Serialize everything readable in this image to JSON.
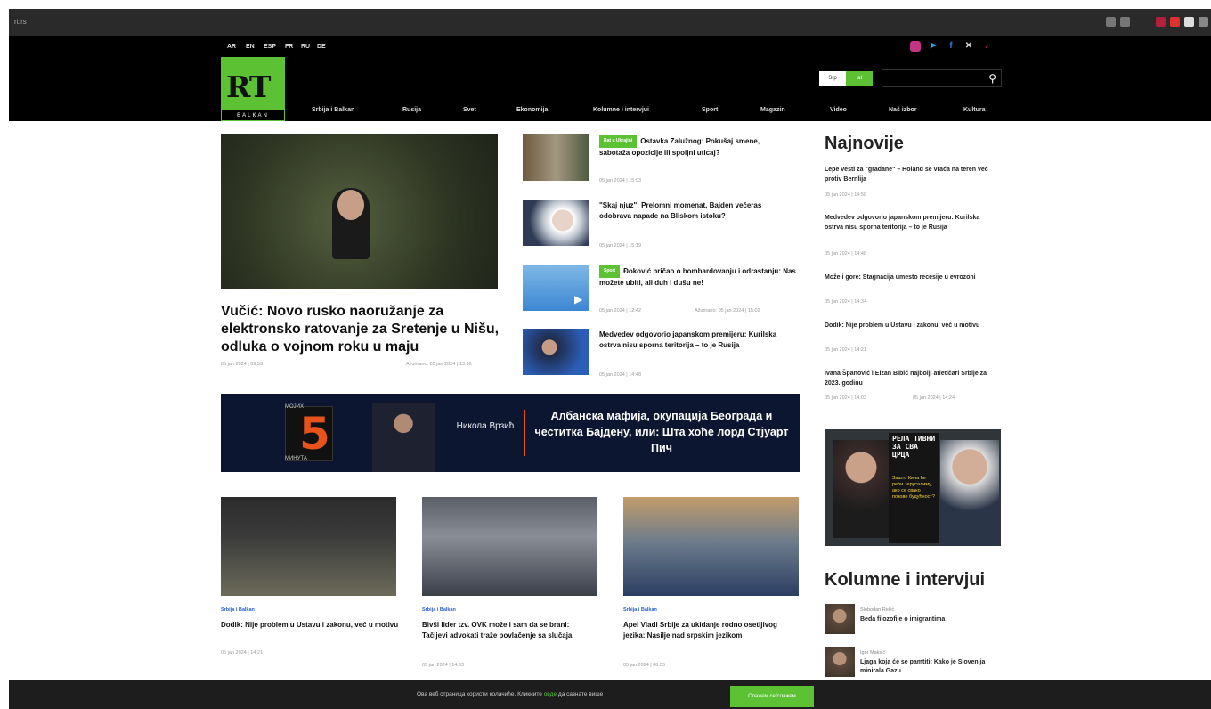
{
  "browser": {
    "url": "rt.rs",
    "extension_colors": [
      "#777777",
      "#777777",
      "#b2213b",
      "#e03030",
      "#dddddd",
      "#888888"
    ]
  },
  "header": {
    "languages": [
      "AR",
      "EN",
      "ESP",
      "FR",
      "RU",
      "DE"
    ],
    "social_icons": [
      "instagram-icon",
      "telegram-icon",
      "facebook-icon",
      "x-icon",
      "tiktok-icon"
    ],
    "logo_text": "RT",
    "logo_sub": "BALKAN",
    "script_toggle": [
      "Srp",
      "lat"
    ],
    "search_placeholder": "",
    "nav": [
      "Srbija i Balkan",
      "Rusija",
      "Svet",
      "Ekonomija",
      "Kolumne i intervjui",
      "Sport",
      "Magazin",
      "Video",
      "Naš izbor",
      "Kultura"
    ],
    "accent": "#5dc233"
  },
  "hero": {
    "title": "Vučić: Novo rusko naoružanje za elektronsko ratovanje za Sretenje u Nišu, odluka o vojnom roku u maju",
    "date": "05 jan 2024 | 09:53",
    "updated": "Ažurirano: 05 jan 2024 | 13:36"
  },
  "mid_articles": [
    {
      "badge": "Rat u Ukrajini",
      "title": "Ostavka Zalužnog: Pokušaj smene, sabotaža opozicije ili spoljni uticaj?",
      "date": "05 jan 2024 | 15:03",
      "updated": ""
    },
    {
      "badge": "",
      "title": "\"Skaj njuz\": Prelomni momenat, Bajden večeras odobrava napade na Bliskom istoku?",
      "date": "05 jan 2024 | 15:19",
      "updated": ""
    },
    {
      "badge": "Sport",
      "title": "Đoković pričao o bombardovanju i odrastanju: Nas možete ubiti, ali duh i dušu ne!",
      "date": "05 jan 2024 | 12:42",
      "updated": "Ažurirano: 05 jan 2024 | 15:02"
    },
    {
      "badge": "",
      "title": "Medvedev odgovorio japanskom premijeru: Kurilska ostrva nisu sporna teritorija – to je Rusija",
      "date": "05 jan 2024 | 14:48",
      "updated": ""
    }
  ],
  "latest": {
    "heading": "Najnovije",
    "items": [
      {
        "title": "Lepe vesti za \"građane\" – Holand se vraća na teren već protiv Bernlija",
        "date": "05 jan 2024 | 14:58",
        "updated": ""
      },
      {
        "title": "Medvedev odgovorio japanskom premijeru: Kurilska ostrva nisu sporna teritorija – to je Rusija",
        "date": "05 jan 2024 | 14:48",
        "updated": ""
      },
      {
        "title": "Može i gore: Stagnacija umesto recesije u evrozoni",
        "date": "05 jan 2024 | 14:34",
        "updated": ""
      },
      {
        "title": "Dodik: Nije problem u Ustavu i zakonu, već u motivu",
        "date": "05 jan 2024 | 14:21",
        "updated": ""
      },
      {
        "title": "Ivana Španović i Elzan Bibić najbolji atletičari Srbije za 2023. godinu",
        "date": "05 jan 2024 | 14:03",
        "updated": "05 jan 2024 | 14:24"
      }
    ]
  },
  "banner": {
    "pre": "МОЈИХ",
    "number": "5",
    "post": "МИНУТА",
    "name": "Никола Врзић",
    "text": "Албанска мафија, окупација Београда и честитка Бајдену, или: Шта хоће лорд Стјуарт Пич"
  },
  "cards": [
    {
      "category": "Srbija i Balkan",
      "title": "Dodik: Nije problem u Ustavu i zakonu, već u motivu",
      "date": "05 jan 2024 | 14:21"
    },
    {
      "category": "Srbija i Balkan",
      "title": "Bivši lider tzv. OVK može i sam da se brani: Tačijevi advokati traže povlačenje sa slučaja",
      "date": "05 jan 2024 | 14:03"
    },
    {
      "category": "Srbija i Balkan",
      "title": "Apel Vladi Srbije za ukidanje rodno osetljivog jezika: Nasilje nad srpskim jezikom",
      "date": "05 jan 2024 | 08:55"
    }
  ],
  "ad": {
    "title": "РЕЛА ТИВНИ ЗА СВА ЦРЦА",
    "subtitle": "Зашто Кина ће рећи Јерусалиму, ако се свако позове будућност?"
  },
  "columns": {
    "heading": "Kolumne i intervjui",
    "items": [
      {
        "author": "Slobodan Reljić",
        "title": "Beda filozofije o imigrantima"
      },
      {
        "author": "Igor Maksić",
        "title": "Ljaga koja će se pamtiti: Kako je Slovenija minirala Gazu"
      }
    ]
  },
  "cookie": {
    "message": "Ова веб страница користи колачиће. Кликните ",
    "link": "овде",
    "message_end": " да сазнате више",
    "button": "Слажем се/слажем"
  }
}
